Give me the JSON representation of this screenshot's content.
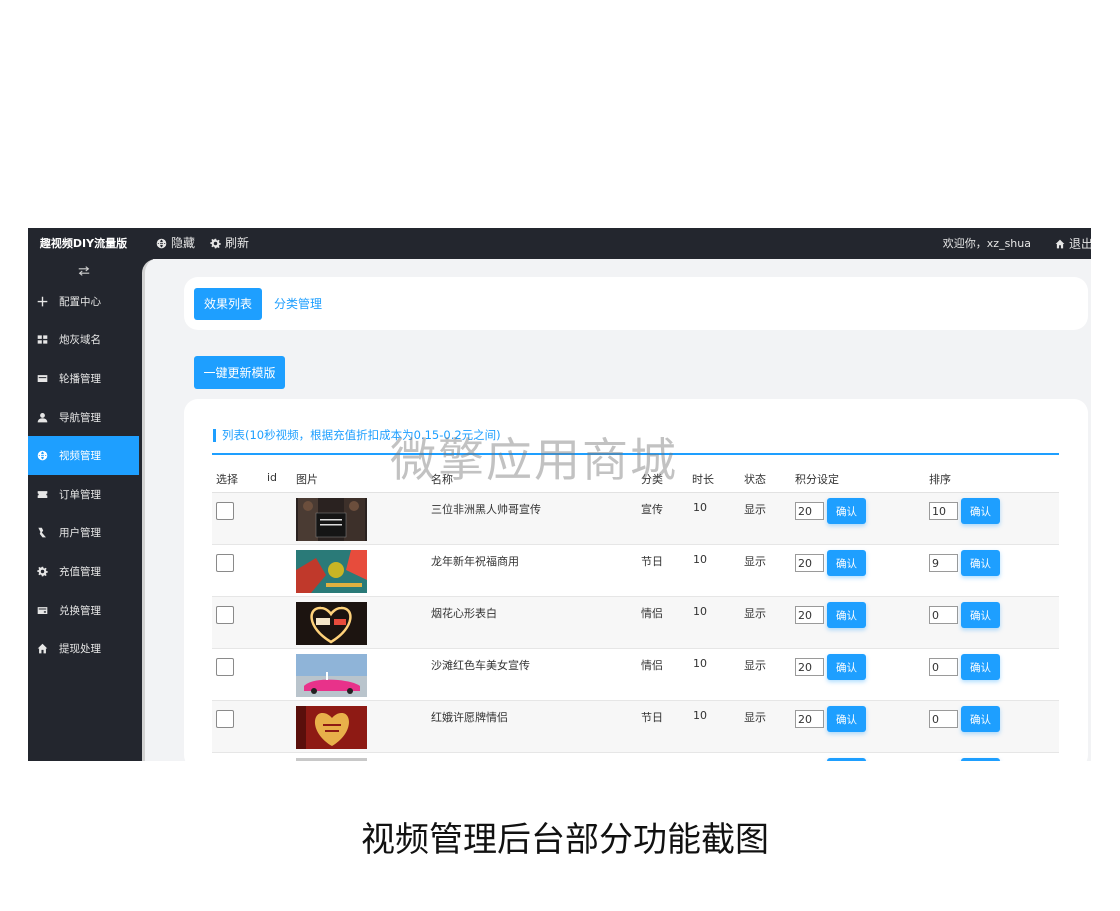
{
  "app": {
    "brand": "趣视频DIY流量版"
  },
  "topbar": {
    "hide_label": "隐藏",
    "refresh_label": "刷新",
    "welcome": "欢迎你，xz_shua",
    "logout_label": "退出"
  },
  "sidebar": {
    "items": [
      {
        "label": "配置中心",
        "icon": "plus-icon"
      },
      {
        "label": "炮灰域名",
        "icon": "grid-icon"
      },
      {
        "label": "轮播管理",
        "icon": "card-icon"
      },
      {
        "label": "导航管理",
        "icon": "user-icon"
      },
      {
        "label": "视频管理",
        "icon": "globe-icon",
        "active": true
      },
      {
        "label": "订单管理",
        "icon": "ticket-icon"
      },
      {
        "label": "用户管理",
        "icon": "users-icon"
      },
      {
        "label": "充值管理",
        "icon": "gear-icon"
      },
      {
        "label": "兑换管理",
        "icon": "wallet-icon"
      },
      {
        "label": "提现处理",
        "icon": "home-icon"
      }
    ]
  },
  "tabs": {
    "active": "效果列表",
    "other": "分类管理"
  },
  "update_button": "一键更新模版",
  "list": {
    "title": "列表(10秒视频，根据充值折扣成本为0.15-0.2元之间)",
    "headers": {
      "select": "选择",
      "id": "id",
      "image": "图片",
      "name": "名称",
      "category": "分类",
      "duration": "时长",
      "status": "状态",
      "points": "积分设定",
      "order": "排序"
    },
    "confirm_label": "确认",
    "rows": [
      {
        "name": "三位非洲黑人帅哥宣传",
        "category": "宣传",
        "duration": "10",
        "status": "显示",
        "points": "20",
        "order": "10"
      },
      {
        "name": "龙年新年祝福商用",
        "category": "节日",
        "duration": "10",
        "status": "显示",
        "points": "20",
        "order": "9"
      },
      {
        "name": "烟花心形表白",
        "category": "情侣",
        "duration": "10",
        "status": "显示",
        "points": "20",
        "order": "0"
      },
      {
        "name": "沙滩红色车美女宣传",
        "category": "情侣",
        "duration": "10",
        "status": "显示",
        "points": "20",
        "order": "0"
      },
      {
        "name": "红娥许愿牌情侣",
        "category": "节日",
        "duration": "10",
        "status": "显示",
        "points": "20",
        "order": "0"
      }
    ]
  },
  "watermark": "微擎应用商城",
  "caption": "视频管理后台部分功能截图",
  "colors": {
    "accent": "#1e9fff",
    "dark": "#23262e"
  }
}
